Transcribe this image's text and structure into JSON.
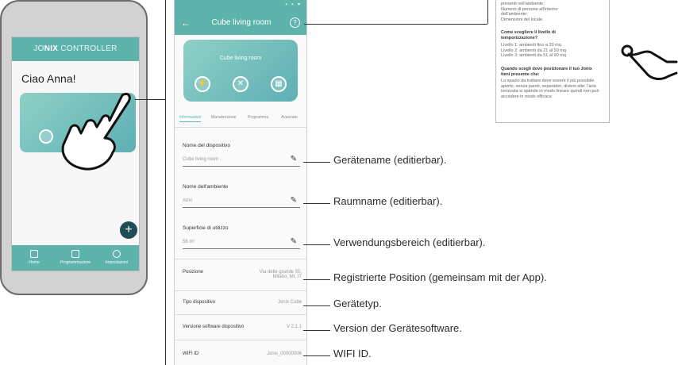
{
  "phone_home": {
    "header_brand_left": "JO",
    "header_brand_bold": "NIX",
    "header_brand_right": " CONTROLLER",
    "greeting": "Ciao Anna!",
    "fab": "+",
    "nav": [
      "Home",
      "Programmazione",
      "Impostazioni"
    ]
  },
  "phone_detail": {
    "status_icons": "▪ ▪ ▾",
    "back": "←",
    "title": "Cube living room",
    "help": "?",
    "card_title": "Cube living room",
    "card_buttons": [
      "⚡",
      "✕",
      "▦"
    ],
    "tabs": [
      "Informazioni",
      "Manutenzione",
      "Programma",
      "Avanzate"
    ],
    "fields": [
      {
        "label": "Nome del dispositivo",
        "value": "Cube living room"
      },
      {
        "label": "Nome dell'ambiente",
        "value": "Atrio"
      },
      {
        "label": "Superficie di utilizzo",
        "value": "58 m²"
      }
    ],
    "rows": [
      {
        "key": "Posizione",
        "value": "Via delle grande 55,\nMilano, MI, IT"
      },
      {
        "key": "Tipo dispositivo",
        "value": "Jonix Cube"
      },
      {
        "key": "Versione software dispositivo",
        "value": "V 2.1.1"
      },
      {
        "key": "WIFI ID",
        "value": "Jonix_00000006"
      }
    ],
    "edit_icon": "✎"
  },
  "callouts": [
    "Gerätename (editierbar).",
    "Raumname (editierbar).",
    "Verwendungsbereich (editierbar).",
    "Registrierte Position (gemeinsam mit der App).",
    "Gerätetyp.",
    "Version der Gerätesoftware.",
    "WIFI ID."
  ],
  "help_panel": {
    "lines": [
      "presenti nell'ambiente;",
      "Numero di persone all'interno",
      "dell'ambiente;",
      "Dimensioni del locale."
    ],
    "heading1": "Come scegliere il livello di temporizzazione?",
    "levels": [
      "Livello 1: ambienti fino a 20 mq",
      "Livello 2: ambienti da 21 al 50 mq",
      "Livello 3: ambienti da 51 al 90 mq"
    ],
    "heading2": "Quando scegli dove posizionare il tuo Jonix tieni presente che:",
    "body": "Lo spazio da trattare deve essere il più possibile aperto, senza pareti, separatori, divieni alte; l'aria ionizzata si spande in modo lineare quindi non può accedere in modo efficace"
  },
  "colors": {
    "teal": "#5fb3ad",
    "arrow_red": "#e05a5a",
    "fab": "#1f4d56"
  }
}
